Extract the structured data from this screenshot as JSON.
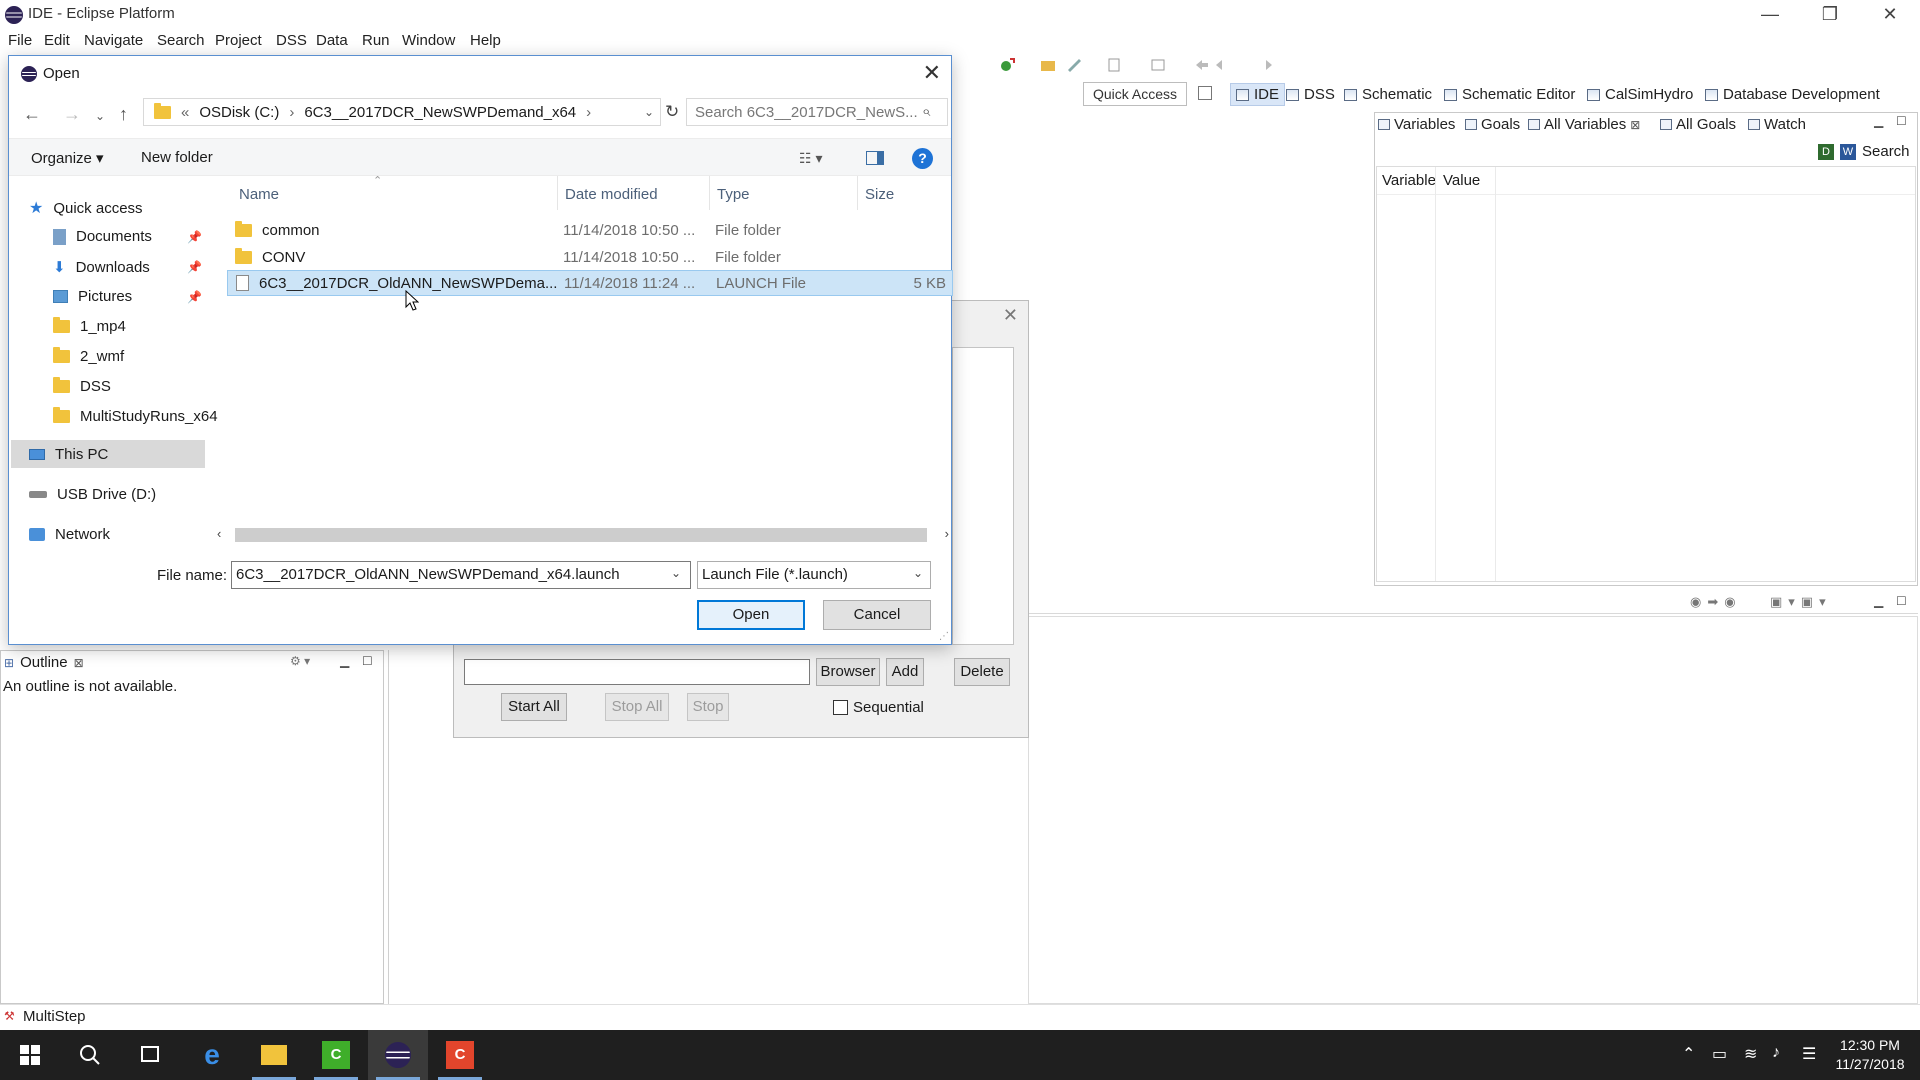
{
  "window": {
    "title": "IDE - Eclipse Platform",
    "controls": {
      "minimize": "—",
      "restore": "❐",
      "close": "✕"
    }
  },
  "menu": [
    "File",
    "Edit",
    "Navigate",
    "Search",
    "Project",
    "DSS",
    "Data",
    "Run",
    "Window",
    "Help"
  ],
  "quick_access": "Quick Access",
  "perspectives": [
    "IDE",
    "DSS",
    "Schematic",
    "Schematic Editor",
    "CalSimHydro",
    "Database Development"
  ],
  "right_panel": {
    "tabs": [
      "Variables",
      "Goals",
      "All Variables",
      "All Goals",
      "Watch"
    ],
    "search_label": "Search",
    "columns": [
      "Variable",
      "Value"
    ]
  },
  "outline": {
    "tab": "Outline",
    "message": "An outline is not available."
  },
  "status": {
    "label": "MultiStep"
  },
  "multistep_dialog": {
    "buttons": {
      "browser": "Browser",
      "add": "Add",
      "delete": "Delete",
      "start_all": "Start All",
      "stop_all": "Stop All",
      "stop": "Stop"
    },
    "sequential_label": "Sequential",
    "close": "✕"
  },
  "open_dialog": {
    "title": "Open",
    "close": "✕",
    "address": {
      "prefix": "«",
      "segments": [
        "OSDisk (C:)",
        "6C3__2017DCR_NewSWPDemand_x64"
      ],
      "separator": "›"
    },
    "search_placeholder": "Search 6C3__2017DCR_NewS...",
    "commands": {
      "organize": "Organize ▾",
      "new_folder": "New folder"
    },
    "nav_pane": {
      "quick_access": "Quick access",
      "pinned": [
        "Documents",
        "Downloads",
        "Pictures"
      ],
      "folders": [
        "1_mp4",
        "2_wmf",
        "DSS",
        "MultiStudyRuns_x64"
      ],
      "this_pc": "This PC",
      "usb": "USB Drive (D:)",
      "network": "Network"
    },
    "columns": {
      "name": "Name",
      "date": "Date modified",
      "type": "Type",
      "size": "Size"
    },
    "files": [
      {
        "name": "common",
        "date": "11/14/2018 10:50 ...",
        "type": "File folder",
        "size": ""
      },
      {
        "name": "CONV",
        "date": "11/14/2018 10:50 ...",
        "type": "File folder",
        "size": ""
      },
      {
        "name": "6C3__2017DCR_OldANN_NewSWPDema...",
        "date": "11/14/2018 11:24 ...",
        "type": "LAUNCH File",
        "size": "5 KB"
      }
    ],
    "selected_file_index": 2,
    "file_name_label": "File name:",
    "file_name_value": "6C3__2017DCR_OldANN_NewSWPDemand_x64.launch",
    "file_type_value": "Launch File (*.launch)",
    "open_button": "Open",
    "cancel_button": "Cancel"
  },
  "taskbar": {
    "apps": [
      "start",
      "search",
      "task-view",
      "edge",
      "file-explorer",
      "green-app",
      "eclipse",
      "red-app"
    ],
    "time": "12:30 PM",
    "date": "11/27/2018"
  }
}
